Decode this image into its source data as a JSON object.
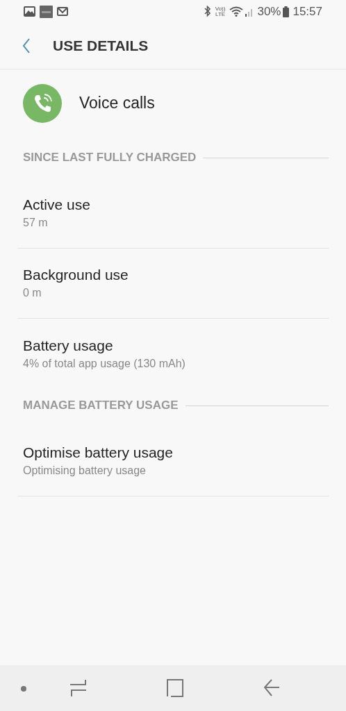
{
  "status_bar": {
    "volte_top": "Vo))",
    "volte_bottom": "LTE",
    "battery_percent": "30%",
    "time": "15:57"
  },
  "header": {
    "title": "USE DETAILS"
  },
  "app": {
    "name": "Voice calls"
  },
  "sections": [
    {
      "title": "SINCE LAST FULLY CHARGED",
      "items": [
        {
          "title": "Active use",
          "subtitle": "57 m"
        },
        {
          "title": "Background use",
          "subtitle": "0 m"
        },
        {
          "title": "Battery usage",
          "subtitle": "4% of total app usage (130 mAh)"
        }
      ]
    },
    {
      "title": "MANAGE BATTERY USAGE",
      "items": [
        {
          "title": "Optimise battery usage",
          "subtitle": "Optimising battery usage"
        }
      ]
    }
  ]
}
